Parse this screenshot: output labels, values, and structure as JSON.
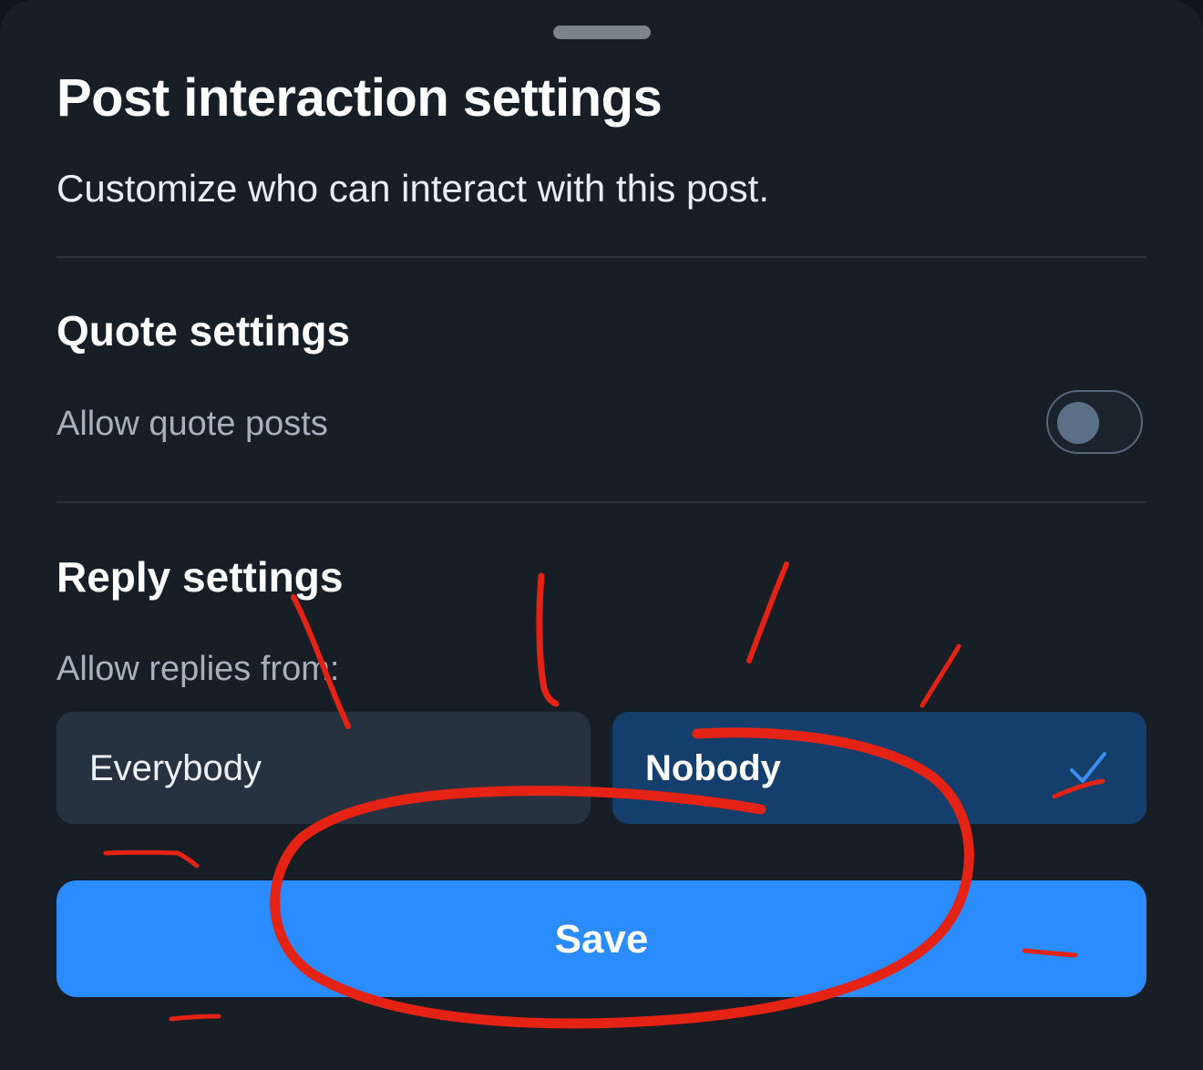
{
  "sheet": {
    "title": "Post interaction settings",
    "subtitle": "Customize who can interact with this post."
  },
  "quote_settings": {
    "heading": "Quote settings",
    "allow_quote_posts_label": "Allow quote posts",
    "allow_quote_posts_enabled": false
  },
  "reply_settings": {
    "heading": "Reply settings",
    "allow_replies_label": "Allow replies from:",
    "options": [
      {
        "label": "Everybody",
        "selected": false
      },
      {
        "label": "Nobody",
        "selected": true
      }
    ]
  },
  "actions": {
    "save_label": "Save"
  },
  "icons": {
    "selected_option": "checkmark-icon"
  },
  "colors": {
    "background": "#171e26",
    "accent": "#2a8cff",
    "selected_option_bg": "#143e6b",
    "unselected_option_bg": "#26323f",
    "annotation": "#e42314"
  }
}
